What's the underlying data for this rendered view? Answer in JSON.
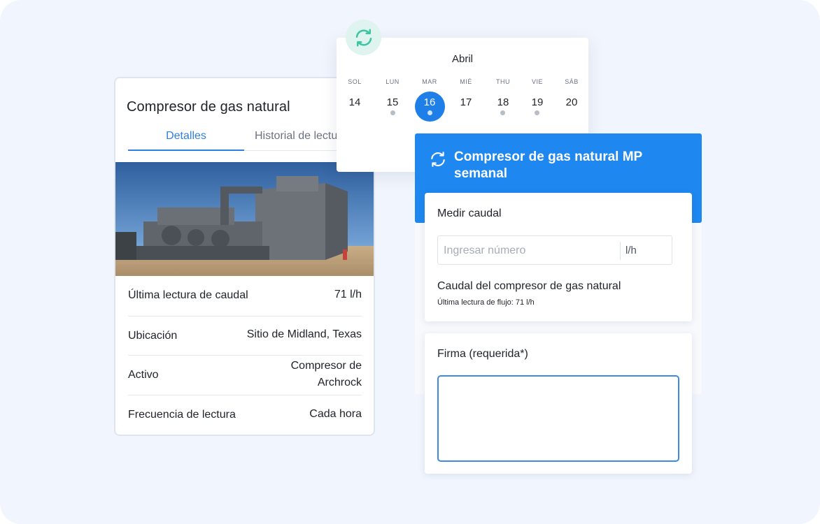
{
  "asset": {
    "title": "Compresor de gas natural",
    "tabs": [
      {
        "label": "Detalles",
        "active": true
      },
      {
        "label": "Historial de lecturas",
        "active": false
      }
    ],
    "details": [
      {
        "label": "Última lectura de caudal",
        "value": "71 l/h"
      },
      {
        "label": "Ubicación",
        "value": "Sitio de Midland, Texas"
      },
      {
        "label": "Activo",
        "value_line1": "Compresor de",
        "value_line2": "Archrock"
      },
      {
        "label": "Frecuencia de lectura",
        "value": "Cada hora"
      }
    ]
  },
  "calendar": {
    "month": "Abril",
    "days": [
      {
        "dow": "SOL",
        "num": "14",
        "dot": false,
        "selected": false
      },
      {
        "dow": "LUN",
        "num": "15",
        "dot": true,
        "selected": false
      },
      {
        "dow": "MAR",
        "num": "16",
        "dot": true,
        "selected": true
      },
      {
        "dow": "MIÉ",
        "num": "17",
        "dot": false,
        "selected": false
      },
      {
        "dow": "THU",
        "num": "18",
        "dot": true,
        "selected": false
      },
      {
        "dow": "VIE",
        "num": "19",
        "dot": true,
        "selected": false
      },
      {
        "dow": "SÁB",
        "num": "20",
        "dot": false,
        "selected": false
      }
    ],
    "sync_icon": "sync-icon"
  },
  "task": {
    "title": "Compresor de gas natural MP semanal",
    "icon": "sync-icon",
    "measure": {
      "label": "Medir caudal",
      "placeholder": "Ingresar número",
      "unit": "l/h",
      "subtitle": "Caudal del compresor de gas natural",
      "note": "Última lectura de flujo: 71 l/h"
    },
    "signature": {
      "label": "Firma (requerida*)"
    }
  },
  "colors": {
    "accent": "#1e87f0",
    "background": "#f1f5fd",
    "sync_badge": "#dff4ee",
    "sync_icon": "#3cc7a2"
  }
}
